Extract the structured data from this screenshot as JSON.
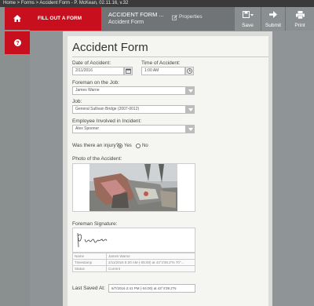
{
  "breadcrumb": "Home > Forms > Accident Form - P. McKean, 02.11.16, v.32",
  "rail": {
    "home_icon": "home-icon",
    "help_icon": "help-icon"
  },
  "header": {
    "fill_tab": "FILL OUT A FORM",
    "form_title": "ACCIDENT FORM ...",
    "form_subtitle": "Accident Form",
    "properties": "Properties",
    "save": "Save",
    "submit": "Submit",
    "print": "Print"
  },
  "form": {
    "heading": "Accident Form",
    "date_label": "Date of Accident:",
    "date_value": "2/11/2016",
    "time_label": "Time of Accident:",
    "time_value": "1:00 AM",
    "foreman_label": "Foreman on the Job:",
    "foreman_value": "James Warne",
    "job_label": "Job:",
    "job_value": "General Sullivan Bridge (2007-0012)",
    "employee_label": "Employee Involved in Incident:",
    "employee_value": "Alex Spooner",
    "injury_label": "Was there an injury?",
    "injury_yes": "Yes",
    "injury_no": "No",
    "injury_selected": "Yes",
    "photo_label": "Photo of the Accident:",
    "signature_label": "Foreman Signature:",
    "signature_rows": [
      {
        "key": "Name",
        "value": "James Warne"
      },
      {
        "key": "Timestamp",
        "value": "2/11/2016 8:20 AM (-05:00) at 43°4'39.2\"N 70°..."
      },
      {
        "key": "Status",
        "value": "Current"
      }
    ],
    "last_saved_label": "Last Saved At:",
    "last_saved_value": "6/7/2016 2:41 PM (-04:00) at 43°4'39.2\"N"
  },
  "colors": {
    "accent": "#c80f1e",
    "toolbar": "#707476",
    "background": "#8f9596"
  }
}
